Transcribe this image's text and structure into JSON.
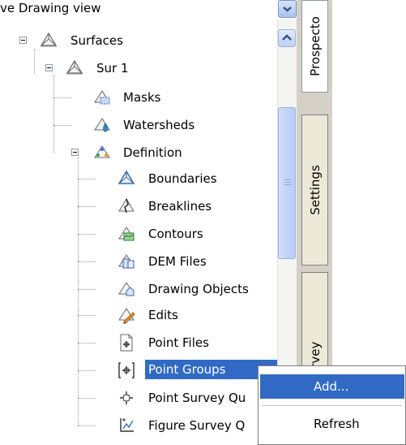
{
  "view_selector": {
    "value": "ve Drawing view"
  },
  "tabs": {
    "prospector": "Prospecto",
    "settings": "Settings",
    "survey": "urvey"
  },
  "tree": {
    "surfaces": "Surfaces",
    "sur1": "Sur 1",
    "masks": "Masks",
    "watersheds": "Watersheds",
    "definition": "Definition",
    "definition_items": [
      "Boundaries",
      "Breaklines",
      "Contours",
      "DEM Files",
      "Drawing Objects",
      "Edits",
      "Point Files",
      "Point Groups",
      "Point Survey Qu",
      "Figure Survey Q"
    ]
  },
  "context_menu": {
    "items": [
      "Add...",
      "Refresh"
    ]
  },
  "colors": {
    "selection": "#316ac5",
    "tab_strip": "#d4d0c8"
  }
}
